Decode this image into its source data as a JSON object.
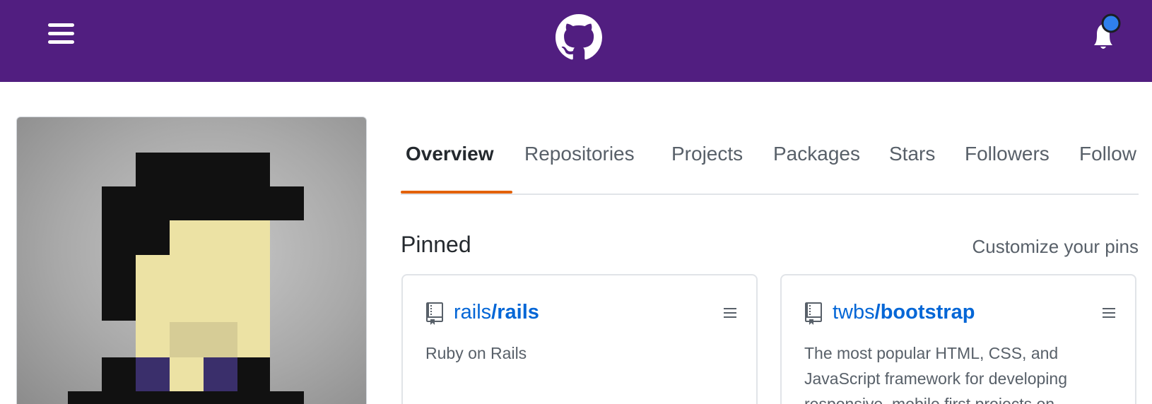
{
  "header": {
    "menu_icon": "hamburger-icon",
    "logo_icon": "github-octocat-icon",
    "notification_icon": "bell-icon",
    "brand_color": "#511e80",
    "unread_dot_color": "#2f80ed"
  },
  "profile": {
    "avatar_icon": "pixel-avatar"
  },
  "tabs": [
    {
      "label": "Overview",
      "active": true
    },
    {
      "label": "Repositories",
      "active": false
    },
    {
      "label": "Projects",
      "active": false
    },
    {
      "label": "Packages",
      "active": false
    },
    {
      "label": "Stars",
      "active": false
    },
    {
      "label": "Followers",
      "active": false
    },
    {
      "label": "Follow",
      "active": false
    }
  ],
  "tab_active_color": "#e36209",
  "pinned": {
    "title": "Pinned",
    "customize_label": "Customize your pins",
    "repos": [
      {
        "owner": "rails",
        "name": "/rails",
        "description": "Ruby on Rails",
        "icon": "repo-book-icon"
      },
      {
        "owner": "twbs",
        "name": "/bootstrap",
        "description": "The most popular HTML, CSS, and JavaScript framework for developing responsive, mobile first projects on",
        "icon": "repo-book-icon"
      }
    ]
  }
}
